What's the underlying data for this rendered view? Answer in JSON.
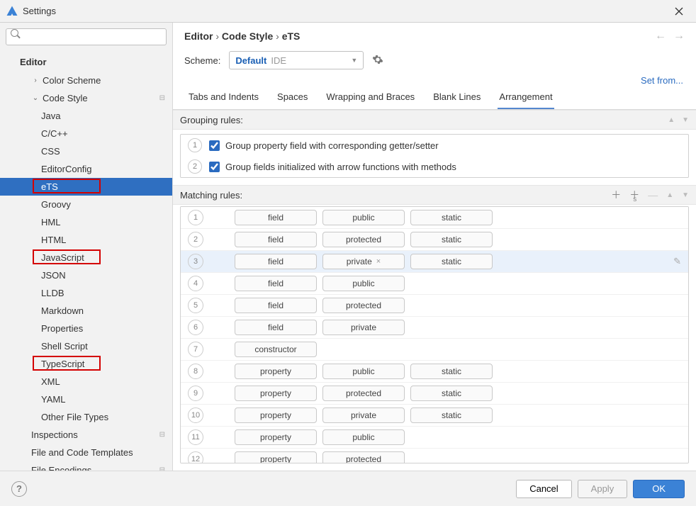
{
  "window": {
    "title": "Settings"
  },
  "sidebar": {
    "heading": "Editor",
    "items": [
      {
        "label": "Color Scheme",
        "level": 1,
        "arrow": "›"
      },
      {
        "label": "Code Style",
        "level": 1,
        "arrow": "⌄",
        "meta": "⊟"
      },
      {
        "label": "Java",
        "level": 2
      },
      {
        "label": "C/C++",
        "level": 2
      },
      {
        "label": "CSS",
        "level": 2
      },
      {
        "label": "EditorConfig",
        "level": 2
      },
      {
        "label": "eTS",
        "level": 2,
        "selected": true,
        "redbox": true
      },
      {
        "label": "Groovy",
        "level": 2
      },
      {
        "label": "HML",
        "level": 2
      },
      {
        "label": "HTML",
        "level": 2
      },
      {
        "label": "JavaScript",
        "level": 2,
        "redbox": true
      },
      {
        "label": "JSON",
        "level": 2
      },
      {
        "label": "LLDB",
        "level": 2
      },
      {
        "label": "Markdown",
        "level": 2
      },
      {
        "label": "Properties",
        "level": 2
      },
      {
        "label": "Shell Script",
        "level": 2
      },
      {
        "label": "TypeScript",
        "level": 2,
        "redbox": true
      },
      {
        "label": "XML",
        "level": 2
      },
      {
        "label": "YAML",
        "level": 2
      },
      {
        "label": "Other File Types",
        "level": 2
      },
      {
        "label": "Inspections",
        "level": 1,
        "meta": "⊟"
      },
      {
        "label": "File and Code Templates",
        "level": 1
      },
      {
        "label": "File Encodings",
        "level": 1,
        "meta": "⊟"
      }
    ]
  },
  "breadcrumb": [
    "Editor",
    "Code Style",
    "eTS"
  ],
  "scheme": {
    "label": "Scheme:",
    "value": "Default",
    "suffix": "IDE"
  },
  "setfrom": "Set from...",
  "tabs": [
    "Tabs and Indents",
    "Spaces",
    "Wrapping and Braces",
    "Blank Lines",
    "Arrangement"
  ],
  "activeTab": 4,
  "grouping": {
    "title": "Grouping rules:",
    "rules": [
      {
        "num": "1",
        "label": "Group property field with corresponding getter/setter",
        "checked": true
      },
      {
        "num": "2",
        "label": "Group fields initialized with arrow functions with methods",
        "checked": true
      }
    ]
  },
  "matching": {
    "title": "Matching rules:",
    "rules": [
      {
        "num": "1",
        "pills": [
          "field",
          "public",
          "static"
        ]
      },
      {
        "num": "2",
        "pills": [
          "field",
          "protected",
          "static"
        ]
      },
      {
        "num": "3",
        "pills": [
          "field",
          "private",
          "static"
        ],
        "selected": true,
        "closeOn": 1
      },
      {
        "num": "4",
        "pills": [
          "field",
          "public"
        ]
      },
      {
        "num": "5",
        "pills": [
          "field",
          "protected"
        ]
      },
      {
        "num": "6",
        "pills": [
          "field",
          "private"
        ]
      },
      {
        "num": "7",
        "pills": [
          "constructor"
        ]
      },
      {
        "num": "8",
        "pills": [
          "property",
          "public",
          "static"
        ]
      },
      {
        "num": "9",
        "pills": [
          "property",
          "protected",
          "static"
        ]
      },
      {
        "num": "10",
        "pills": [
          "property",
          "private",
          "static"
        ]
      },
      {
        "num": "11",
        "pills": [
          "property",
          "public"
        ]
      },
      {
        "num": "12",
        "pills": [
          "property",
          "protected"
        ]
      }
    ]
  },
  "footer": {
    "cancel": "Cancel",
    "apply": "Apply",
    "ok": "OK"
  }
}
